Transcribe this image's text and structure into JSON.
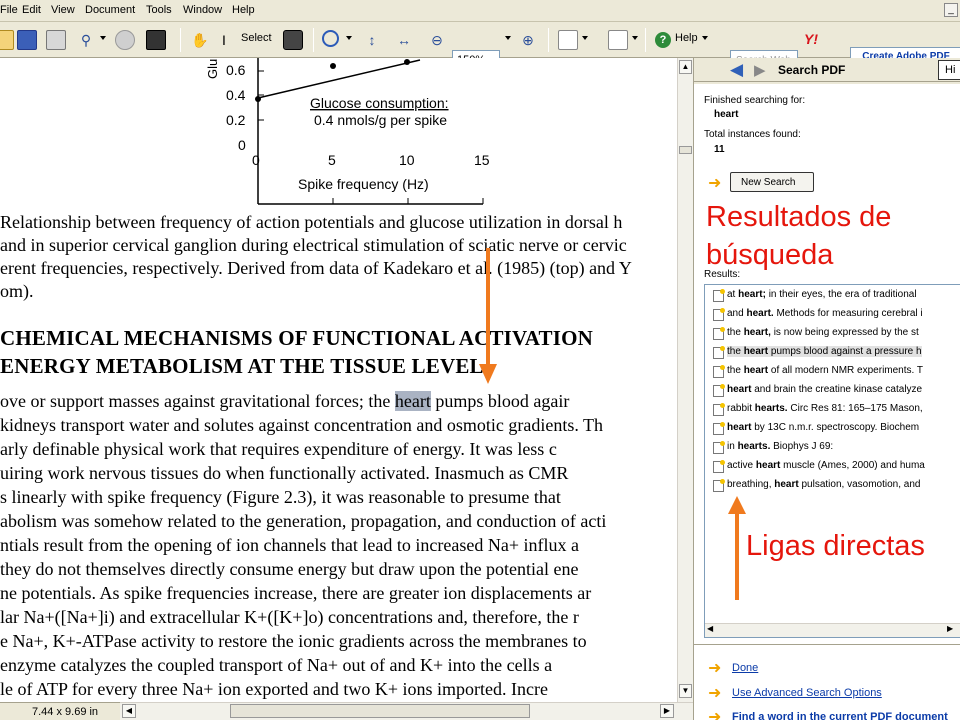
{
  "menu": [
    "File",
    "Edit",
    "View",
    "Document",
    "Tools",
    "Window",
    "Help"
  ],
  "toolbar": {
    "select_label": "Select",
    "zoom_value": "150%",
    "help_label": "Help",
    "search_web_placeholder": "Search Web",
    "create_pdf_label": "Create Adobe PDF online free!"
  },
  "chart": {
    "ylabel": "Glu",
    "yticks": [
      "0.6",
      "0.4",
      "0.2",
      "0"
    ],
    "xticks": [
      "0",
      "5",
      "10",
      "15"
    ],
    "xlabel": "Spike frequency (Hz)",
    "annotation_line1": "Glucose consumption:",
    "annotation_line2": "0.4 nmols/g per spike"
  },
  "document": {
    "caption": [
      "Relationship between frequency of action potentials and glucose utilization in dorsal h",
      "and in superior cervical ganglion during electrical stimulation of sciatic nerve or cervic",
      "erent frequencies, respectively. Derived from data of Kadekaro et al. (1985) (top) and Y",
      "om)."
    ],
    "heading1": "CHEMICAL MECHANISMS OF FUNCTIONAL ACTIVATION",
    "heading2": "ENERGY METABOLISM AT THE TISSUE LEVEL",
    "body_first_before": "ove or support masses against gravitational forces; the ",
    "highlight": "heart",
    "body_first_after": " pumps blood agair",
    "body": [
      "kidneys transport water and solutes against concentration and osmotic gradients. Th",
      "arly definable physical work that requires expenditure of energy. It was less c",
      "uiring work nervous tissues do when functionally activated. Inasmuch as CMR",
      "s linearly with spike frequency (Figure 2.3), it was reasonable to presume that",
      "abolism was somehow related to the generation, propagation, and conduction of acti",
      "ntials result from the opening of ion channels that lead to increased Na+ influx a",
      "they do not themselves directly consume energy but draw upon the potential ene",
      "ne potentials. As spike frequencies increase, there are greater ion displacements ar",
      "lar Na+([Na+]i) and extracellular K+([K+]o) concentrations and, therefore, the r",
      "e Na+, K+-ATPase activity to restore the ionic gradients across the membranes to",
      "enzyme catalyzes the coupled transport of Na+ out of and K+ into the cells a",
      "le of ATP for every three Na+ ion exported and two K+ ions imported. Incre"
    ]
  },
  "status": {
    "page_size": "7.44 x 9.69 in"
  },
  "panel": {
    "title": "Search PDF",
    "hide_label": "Hi",
    "finished_label": "Finished searching for:",
    "search_term": "heart",
    "total_label": "Total instances found:",
    "total_value": "11",
    "new_search_label": "New Search",
    "results_label": "Results:",
    "results": [
      {
        "bold": "heart;",
        "before": "at ",
        "after": " in their eyes, the era of traditional"
      },
      {
        "bold": "heart.",
        "before": "and ",
        "after": " Methods for measuring cerebral i"
      },
      {
        "bold": "heart,",
        "before": "the ",
        "after": " is now being expressed by the st"
      },
      {
        "bold": "heart",
        "before": "the ",
        "after": " pumps blood against a pressure h"
      },
      {
        "bold": "heart",
        "before": "the ",
        "after": " of all modern NMR experiments. T"
      },
      {
        "bold": "heart",
        "before": "",
        "after": " and brain the creatine kinase catalyze"
      },
      {
        "bold": "hearts.",
        "before": "rabbit ",
        "after": " Circ Res 81: 165–175 Mason,"
      },
      {
        "bold": "heart",
        "before": "",
        "after": " by 13C n.m.r. spectroscopy. Biochem"
      },
      {
        "bold": "hearts.",
        "before": "in ",
        "after": " Biophys J 69:"
      },
      {
        "bold": "heart",
        "before": "active ",
        "after": " muscle (Ames, 2000) and huma"
      },
      {
        "bold": "heart",
        "before": "breathing, ",
        "after": " pulsation, vasomotion, and"
      }
    ],
    "done_label": "Done",
    "advanced_label": "Use Advanced Search Options",
    "find_label": "Find a word in the current PDF document"
  },
  "annotations": {
    "results_note_line1": "Resultados de",
    "results_note_line2": "búsqueda",
    "links_note": "Ligas directas"
  },
  "colors": {
    "annotation": "#e5160c",
    "arrow": "#f07a1e",
    "link": "#0b3ba8"
  }
}
